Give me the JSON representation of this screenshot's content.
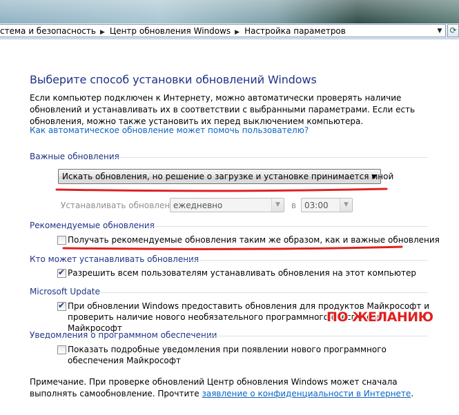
{
  "address_bar": {
    "crumbs": [
      "стема и безопасность",
      "Центр обновления Windows",
      "Настройка параметров"
    ],
    "separator_icon": "chevron-right-icon"
  },
  "page": {
    "heading": "Выберите способ установки обновлений Windows",
    "intro": "Если компьютер подключен к Интернету, можно автоматически проверять наличие обновлений и устанавливать их в соответствии с выбранными параметрами. Если есть обновления, можно также установить их перед выключением компьютера.",
    "help_link": "Как автоматическое обновление может помочь пользователю?"
  },
  "important": {
    "section_title": "Важные обновления",
    "mode_selected": "Искать обновления, но решение о загрузке и установке принимается мной",
    "schedule_label": "Устанавливать обновления:",
    "frequency": "ежедневно",
    "at_label": "в",
    "time": "03:00"
  },
  "recommended": {
    "section_title": "Рекомендуемые обновления",
    "checkbox_label": "Получать рекомендуемые обновления таким же образом, как и важные обновления",
    "checked": false
  },
  "who": {
    "section_title": "Кто может устанавливать обновления",
    "checkbox_label": "Разрешить всем пользователям устанавливать обновления на этот компьютер",
    "checked": true
  },
  "microsoft_update": {
    "section_title": "Microsoft Update",
    "checkbox_label": "При обновлении Windows предоставить обновления для продуктов Майкрософт и проверить наличие нового необязательного программного обеспечения Майкрософт",
    "checked": true
  },
  "notifications": {
    "section_title": "Уведомления о программном обеспечении",
    "checkbox_label": "Показать подробные уведомления при появлении нового программного обеспечения Майкрософт",
    "checked": false
  },
  "annotation": {
    "text": "ПО ЖЕЛАНИЮ",
    "color": "#e0201f"
  },
  "note": {
    "text": "Примечание. При проверке обновлений Центр обновления Windows может сначала выполнять самообновление. Прочтите ",
    "link": "заявление о конфиденциальности в Интернете",
    "end": "."
  }
}
